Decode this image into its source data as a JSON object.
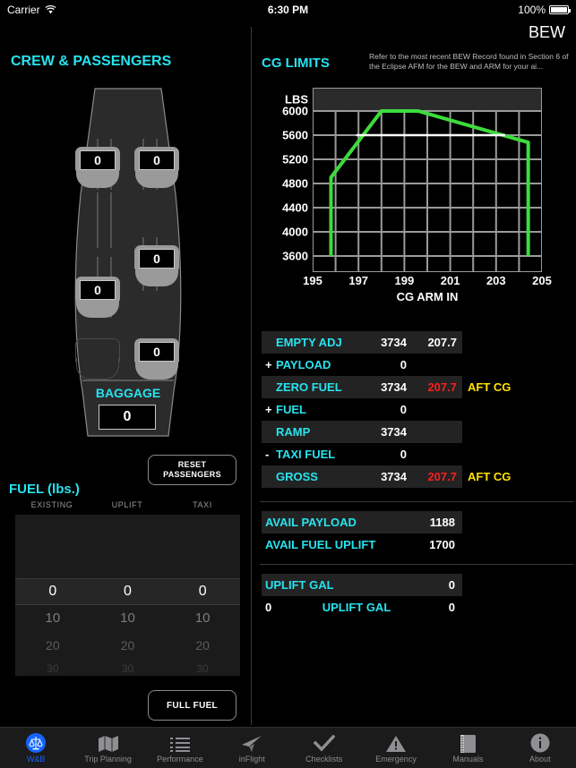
{
  "statusbar": {
    "carrier": "Carrier",
    "wifi_icon": "wifi-icon",
    "time": "6:30 PM",
    "battery_pct": "100%"
  },
  "header": {
    "bew_title": "BEW",
    "note": "Refer to the most recent BEW Record found in Section 6 of the Eclipse AFM for the BEW and ARM for your ai..."
  },
  "crew": {
    "heading": "CREW & PASSENGERS",
    "seats": [
      {
        "name": "seat-pilot",
        "value": "0",
        "empty": false
      },
      {
        "name": "seat-copilot",
        "value": "0",
        "empty": false
      },
      {
        "name": "seat-mid-right",
        "value": "0",
        "empty": false
      },
      {
        "name": "seat-mid-left",
        "value": "0",
        "empty": false
      },
      {
        "name": "seat-aft-left",
        "value": "",
        "empty": true
      },
      {
        "name": "seat-aft-right",
        "value": "0",
        "empty": false
      }
    ],
    "baggage_label": "BAGGAGE",
    "baggage_value": "0",
    "reset_button": "RESET PASSENGERS"
  },
  "fuel": {
    "heading": "FUEL (lbs.)",
    "columns": [
      "EXISTING",
      "UPLIFT",
      "TAXI"
    ],
    "pickers": [
      {
        "name": "existing",
        "selected": "0",
        "below": [
          "10",
          "20",
          "30"
        ]
      },
      {
        "name": "uplift",
        "selected": "0",
        "below": [
          "10",
          "20",
          "30"
        ]
      },
      {
        "name": "taxi",
        "selected": "0",
        "below": [
          "10",
          "20",
          "30"
        ]
      }
    ],
    "full_fuel_button": "FULL FUEL"
  },
  "cg": {
    "heading": "CG LIMITS",
    "lbs_header": "LBS",
    "axis_title": "CG ARM IN"
  },
  "chart_data": {
    "type": "line",
    "title": "CG LIMITS",
    "xlabel": "CG ARM IN",
    "ylabel": "LBS",
    "xlim": [
      195,
      205
    ],
    "ylim": [
      3600,
      6100
    ],
    "xticks": [
      195,
      197,
      199,
      201,
      203,
      205
    ],
    "yticks": [
      3600,
      4000,
      4400,
      4800,
      5200,
      5600,
      6000
    ],
    "grid": true,
    "legend": "none",
    "series": [
      {
        "name": "CG envelope",
        "color": "#3ddc3d",
        "x": [
          195.8,
          195.8,
          198.0,
          199.6,
          204.4,
          204.4
        ],
        "y": [
          3600,
          4900,
          6000,
          6000,
          5480,
          3600
        ]
      },
      {
        "name": "current gross weight line",
        "color": "#ffffff",
        "x": [
          196.9,
          203.4
        ],
        "y": [
          5600,
          5600
        ]
      }
    ]
  },
  "wb_rows": [
    {
      "name": "empty-adj",
      "sign": "",
      "label": "EMPTY ADJ",
      "weight": "3734",
      "arm": "207.7",
      "arm_warn": false,
      "flag": "",
      "shaded": true
    },
    {
      "name": "payload",
      "sign": "+",
      "label": "PAYLOAD",
      "weight": "0",
      "arm": "",
      "arm_warn": false,
      "flag": "",
      "shaded": false
    },
    {
      "name": "zero-fuel",
      "sign": "",
      "label": "ZERO FUEL",
      "weight": "3734",
      "arm": "207.7",
      "arm_warn": true,
      "flag": "AFT CG",
      "shaded": true
    },
    {
      "name": "fuel",
      "sign": "+",
      "label": "FUEL",
      "weight": "0",
      "arm": "",
      "arm_warn": false,
      "flag": "",
      "shaded": false
    },
    {
      "name": "ramp",
      "sign": "",
      "label": "RAMP",
      "weight": "3734",
      "arm": "",
      "arm_warn": false,
      "flag": "",
      "shaded": true
    },
    {
      "name": "taxi-fuel",
      "sign": "-",
      "label": "TAXI FUEL",
      "weight": "0",
      "arm": "",
      "arm_warn": false,
      "flag": "",
      "shaded": false
    },
    {
      "name": "gross",
      "sign": "",
      "label": "GROSS",
      "weight": "3734",
      "arm": "207.7",
      "arm_warn": true,
      "flag": "AFT CG",
      "shaded": true
    }
  ],
  "avail_rows": [
    {
      "name": "avail-payload",
      "label": "AVAIL PAYLOAD",
      "value": "1188",
      "shaded": true
    },
    {
      "name": "avail-fuel-uplift",
      "label": "AVAIL FUEL UPLIFT",
      "value": "1700",
      "shaded": false
    }
  ],
  "uplift_rows": [
    {
      "name": "uplift-gal-1",
      "pre": "",
      "label": "UPLIFT GAL",
      "value": "0",
      "shaded": true,
      "label_left": true
    },
    {
      "name": "uplift-gal-2",
      "pre": "0",
      "label": "UPLIFT GAL",
      "value": "0",
      "shaded": false,
      "label_left": false
    }
  ],
  "tabs": [
    {
      "name": "tab-wb",
      "label": "W&B",
      "icon": "scales-icon",
      "active": true
    },
    {
      "name": "tab-trip-planning",
      "label": "Trip Planning",
      "icon": "map-icon",
      "active": false
    },
    {
      "name": "tab-performance",
      "label": "Performance",
      "icon": "list-icon",
      "active": false
    },
    {
      "name": "tab-inflight",
      "label": "inFlight",
      "icon": "paper-plane-icon",
      "active": false
    },
    {
      "name": "tab-checklists",
      "label": "Checklists",
      "icon": "checkmark-icon",
      "active": false
    },
    {
      "name": "tab-emergency",
      "label": "Emergency",
      "icon": "warning-icon",
      "active": false
    },
    {
      "name": "tab-manuals",
      "label": "Manuals",
      "icon": "book-icon",
      "active": false
    },
    {
      "name": "tab-about",
      "label": "About",
      "icon": "info-icon",
      "active": false
    }
  ],
  "colors": {
    "accent_cyan": "#27e3ee",
    "envelope_green": "#3ddc3d",
    "warn_red": "#ff1d1d",
    "flag_yellow": "#ffe100",
    "active_blue": "#1464ff"
  }
}
